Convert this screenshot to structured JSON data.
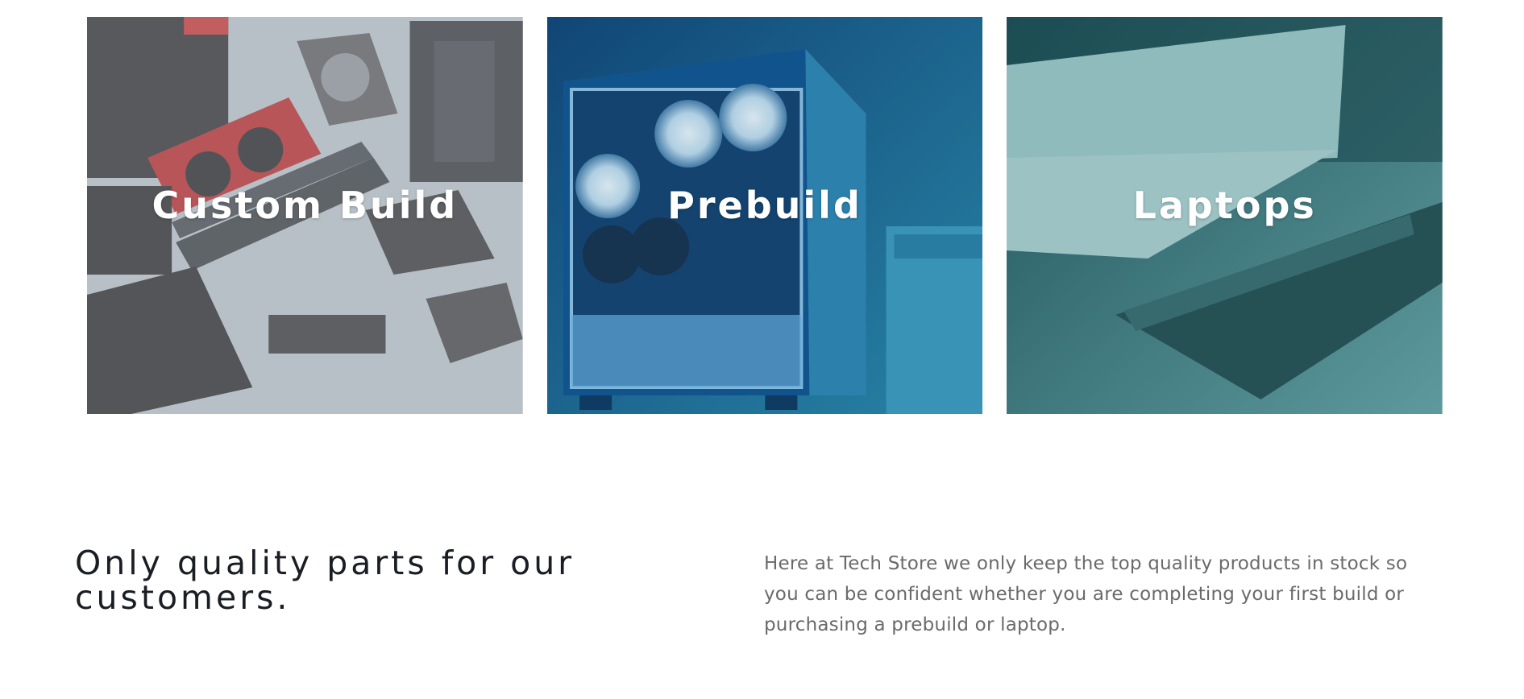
{
  "categories": [
    {
      "label": "Custom Build",
      "icon": "pc-parts-image"
    },
    {
      "label": "Prebuild",
      "icon": "gaming-pc-case-image"
    },
    {
      "label": "Laptops",
      "icon": "laptops-image"
    }
  ],
  "about": {
    "heading": "Only quality parts for our customers.",
    "text": "Here at Tech Store we only keep the top quality products in stock so you can be confident whether you are completing your first build or purchasing a prebuild or laptop."
  },
  "colors": {
    "custom_build_overlay": "#b9c1c8",
    "prebuild_overlay": "#1f6f9a",
    "laptops_overlay": "#2d6f73",
    "heading": "#1a1d24",
    "body_text": "#6a6a6a"
  }
}
